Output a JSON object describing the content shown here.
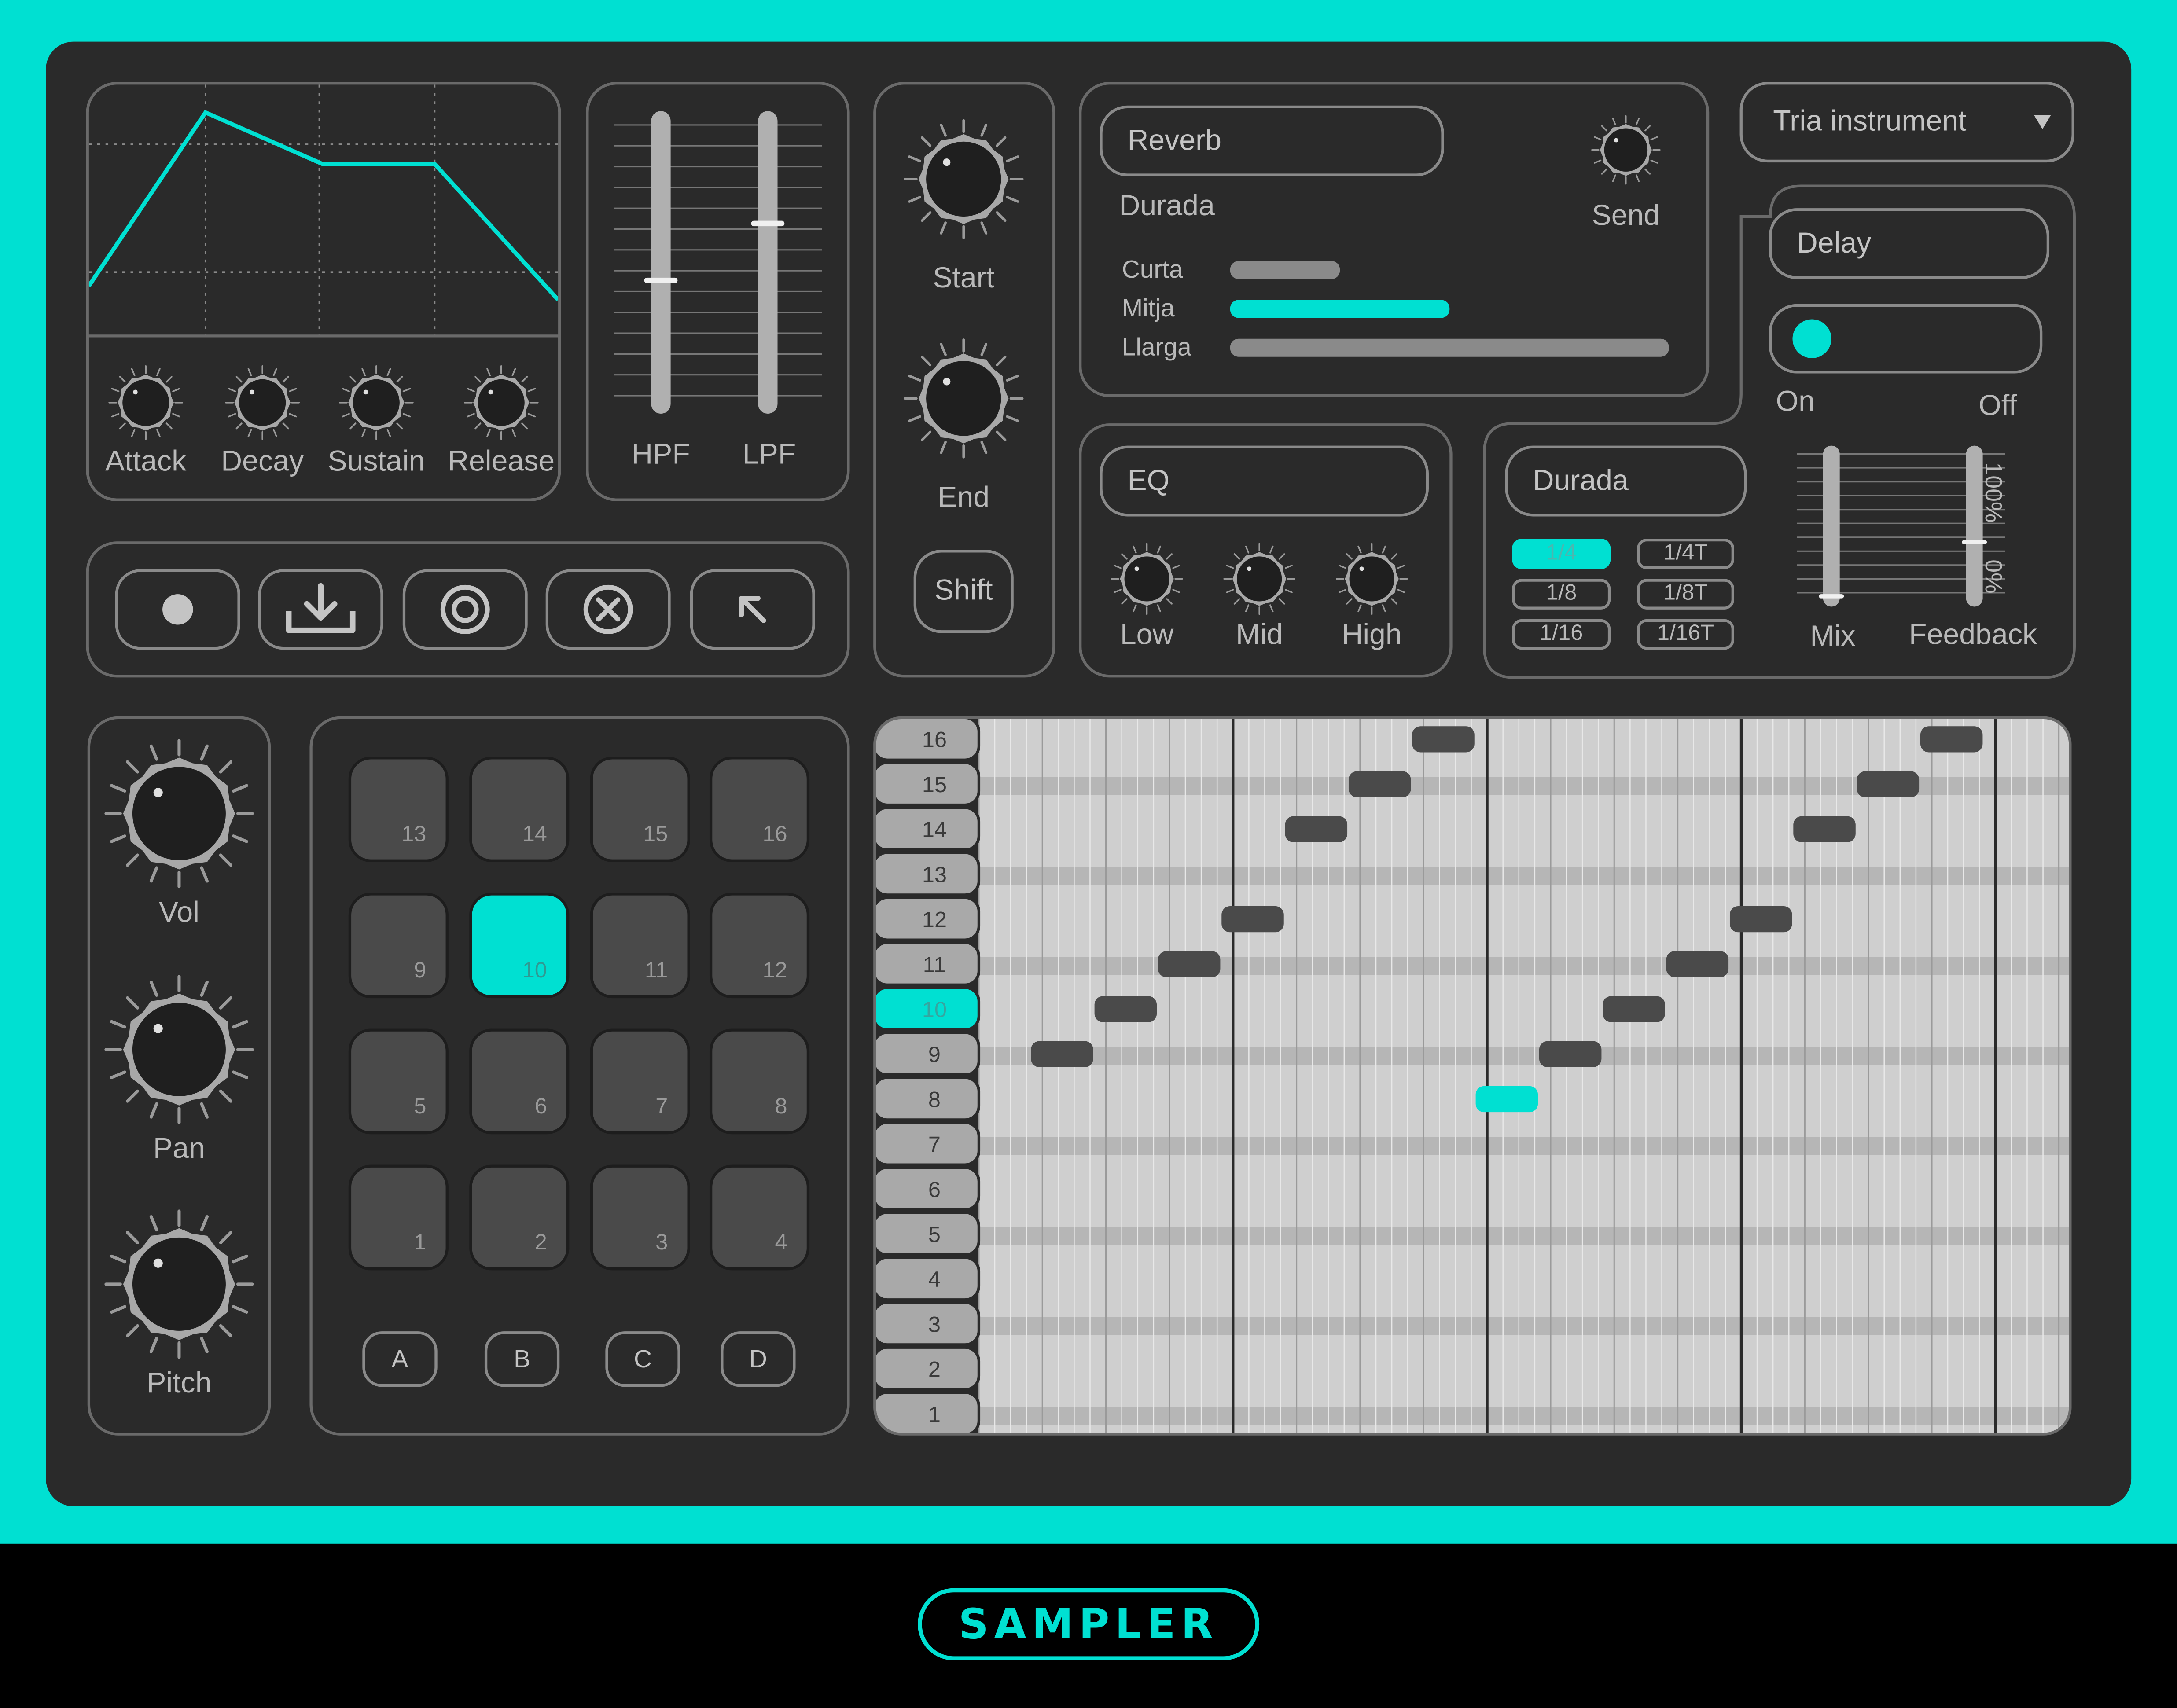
{
  "brand": {
    "logo_text": "SAMPLER",
    "accent_color": "#00e0d2",
    "panel_color": "#2a2a2a"
  },
  "envelope": {
    "knobs": [
      {
        "label": "Attack"
      },
      {
        "label": "Decay"
      },
      {
        "label": "Sustain"
      },
      {
        "label": "Release"
      }
    ]
  },
  "filters": {
    "hpf_label": "HPF",
    "lpf_label": "LPF",
    "hpf_level": 0.44,
    "lpf_level": 0.63
  },
  "sample": {
    "start_label": "Start",
    "end_label": "End",
    "shift_label": "Shift"
  },
  "transport": {
    "buttons": [
      {
        "name": "record-icon"
      },
      {
        "name": "download-icon"
      },
      {
        "name": "target-icon"
      },
      {
        "name": "clear-icon"
      },
      {
        "name": "arrow-up-left-icon"
      }
    ]
  },
  "reverb": {
    "title": "Reverb",
    "send_label": "Send",
    "duration_label": "Durada",
    "options": [
      {
        "label": "Curta",
        "level": 0.25,
        "active": false
      },
      {
        "label": "Mitja",
        "level": 0.5,
        "active": true
      },
      {
        "label": "Llarga",
        "level": 1.0,
        "active": false
      }
    ]
  },
  "instrument_select": {
    "value": "Tria instrument"
  },
  "eq": {
    "title": "EQ",
    "knobs": [
      {
        "label": "Low"
      },
      {
        "label": "Mid"
      },
      {
        "label": "High"
      }
    ]
  },
  "duration": {
    "title": "Durada",
    "options": [
      "1/4",
      "1/4T",
      "1/8",
      "1/8T",
      "1/16",
      "1/16T"
    ],
    "selected": "1/4"
  },
  "delay": {
    "title": "Delay",
    "on_label": "On",
    "off_label": "Off",
    "state": "on",
    "mix_label": "Mix",
    "feedback_label": "Feedback",
    "scale_top": "100%",
    "scale_bottom": "0%",
    "mix_level": 0.05,
    "feedback_level": 0.4
  },
  "channel": {
    "knobs": [
      {
        "label": "Vol"
      },
      {
        "label": "Pan"
      },
      {
        "label": "Pitch"
      }
    ]
  },
  "pads": {
    "rows": [
      [
        "13",
        "14",
        "15",
        "16"
      ],
      [
        "9",
        "10",
        "11",
        "12"
      ],
      [
        "5",
        "6",
        "7",
        "8"
      ],
      [
        "1",
        "2",
        "3",
        "4"
      ]
    ],
    "active": "10",
    "banks": [
      "A",
      "B",
      "C",
      "D"
    ]
  },
  "sequencer": {
    "rows": [
      "16",
      "15",
      "14",
      "13",
      "12",
      "11",
      "10",
      "9",
      "8",
      "7",
      "6",
      "5",
      "4",
      "3",
      "2",
      "1"
    ],
    "selected_row": "10",
    "steps": 16,
    "notes": [
      {
        "step": 1,
        "row": 9,
        "active": false
      },
      {
        "step": 2,
        "row": 10,
        "active": false
      },
      {
        "step": 3,
        "row": 11,
        "active": false
      },
      {
        "step": 4,
        "row": 12,
        "active": false
      },
      {
        "step": 5,
        "row": 14,
        "active": false
      },
      {
        "step": 6,
        "row": 15,
        "active": false
      },
      {
        "step": 7,
        "row": 16,
        "active": false
      },
      {
        "step": 8,
        "row": 8,
        "active": true
      },
      {
        "step": 9,
        "row": 9,
        "active": false
      },
      {
        "step": 10,
        "row": 10,
        "active": false
      },
      {
        "step": 11,
        "row": 11,
        "active": false
      },
      {
        "step": 12,
        "row": 12,
        "active": false
      },
      {
        "step": 13,
        "row": 14,
        "active": false
      },
      {
        "step": 14,
        "row": 15,
        "active": false
      },
      {
        "step": 15,
        "row": 16,
        "active": false
      }
    ]
  }
}
